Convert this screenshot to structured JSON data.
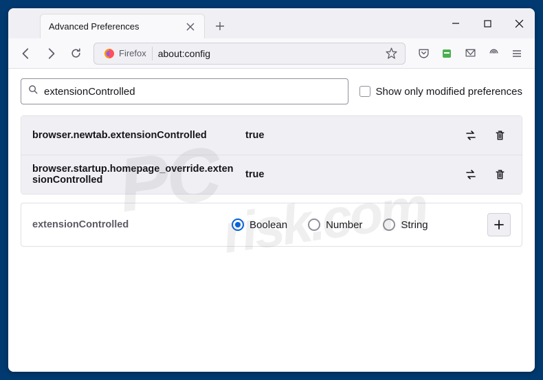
{
  "window": {
    "tab_title": "Advanced Preferences"
  },
  "toolbar": {
    "identity_label": "Firefox",
    "url": "about:config"
  },
  "search": {
    "value": "extensionControlled",
    "checkbox_label": "Show only modified preferences"
  },
  "prefs": [
    {
      "name": "browser.newtab.extensionControlled",
      "value": "true"
    },
    {
      "name": "browser.startup.homepage_override.extensionControlled",
      "value": "true"
    }
  ],
  "add_row": {
    "name": "extensionControlled",
    "options": [
      "Boolean",
      "Number",
      "String"
    ],
    "selected": "Boolean"
  },
  "watermark": {
    "line1": "PC",
    "line2": "risk.com"
  }
}
